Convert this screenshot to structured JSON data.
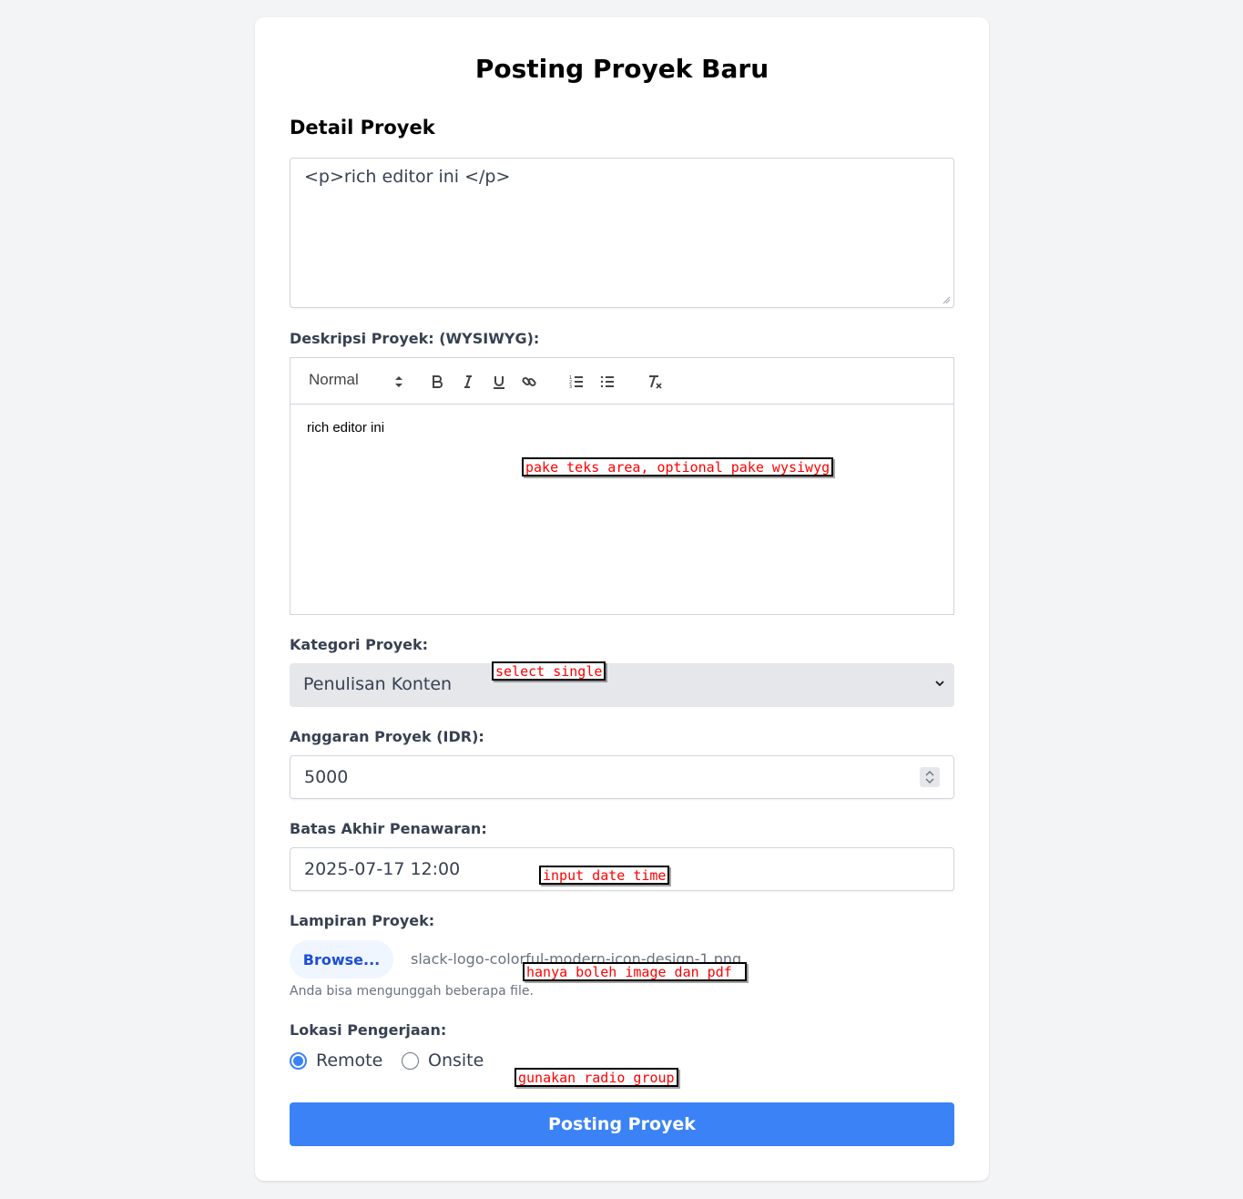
{
  "page": {
    "title": "Posting Proyek Baru",
    "section_title": "Detail Proyek"
  },
  "detail_textarea": {
    "value": "<p>rich editor ini </p>"
  },
  "description": {
    "label": "Deskripsi Proyek: (WYSIWYG):",
    "toolbar": {
      "format_select": "Normal",
      "buttons": [
        "bold-icon",
        "italic-icon",
        "underline-icon",
        "link-icon",
        "ordered-list-icon",
        "bullet-list-icon",
        "clear-format-icon"
      ]
    },
    "editor_text": "rich editor ini"
  },
  "category": {
    "label": "Kategori Proyek:",
    "selected": "Penulisan Konten"
  },
  "budget": {
    "label": "Anggaran Proyek (IDR):",
    "value": "5000"
  },
  "deadline": {
    "label": "Batas Akhir Penawaran:",
    "value": "2025-07-17 12:00"
  },
  "attachment": {
    "label": "Lampiran Proyek:",
    "browse_label": "Browse...",
    "filename": "slack-logo-colorful-modern-icon-design-1.png",
    "hint": "Anda bisa mengunggah beberapa file."
  },
  "location": {
    "label": "Lokasi Pengerjaan:",
    "options": [
      {
        "label": "Remote",
        "checked": true
      },
      {
        "label": "Onsite",
        "checked": false
      }
    ]
  },
  "submit_label": "Posting Proyek",
  "annotations": {
    "editor_note": "pake teks area, optional pake wysiwyg",
    "select_note": "select single",
    "datetime_note": "input date time",
    "file_note": "hanya boleh image dan pdf",
    "radio_note": "gunakan radio group"
  },
  "colors": {
    "primary": "#3b82f6",
    "annotation_text": "#ff0000",
    "browse_text": "#1d4ed8",
    "background": "#f3f4f6"
  }
}
